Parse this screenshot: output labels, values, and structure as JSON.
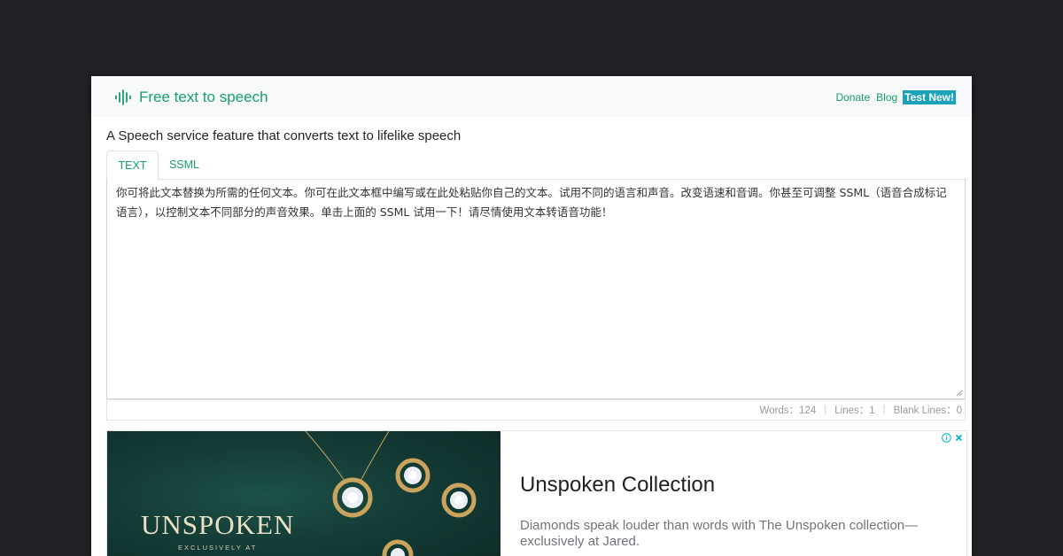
{
  "app": {
    "brand_title": "Free text to speech",
    "brand_icon": "soundwave-icon",
    "brand_color": "#17a067"
  },
  "nav": {
    "donate": "Donate",
    "blog": "Blog",
    "test_new": "Test New!",
    "badge_color": "#1aa3b8"
  },
  "subtitle": "A Speech service feature that converts text to lifelike speech",
  "tabs": [
    {
      "label": "TEXT",
      "active": true
    },
    {
      "label": "SSML",
      "active": false
    }
  ],
  "editor": {
    "text": "你可将此文本替换为所需的任何文本。你可在此文本框中编写或在此处粘贴你自己的文本。试用不同的语言和声音。改变语速和音调。你甚至可调整 SSML（语音合成标记语言），以控制文本不同部分的声音效果。单击上面的 SSML 试用一下！请尽情使用文本转语音功能！"
  },
  "stats": {
    "words": "Words：124",
    "lines": "Lines：1",
    "blank_lines": "Blank Lines：0"
  },
  "ad": {
    "image_brand": "UNSPOKEN",
    "image_subtext": "EXCLUSIVELY AT",
    "title": "Unspoken Collection",
    "description": "Diamonds speak louder than words with The Unspoken collection—exclusively at Jared.",
    "choices_icons": [
      "info-icon",
      "close-icon"
    ]
  }
}
